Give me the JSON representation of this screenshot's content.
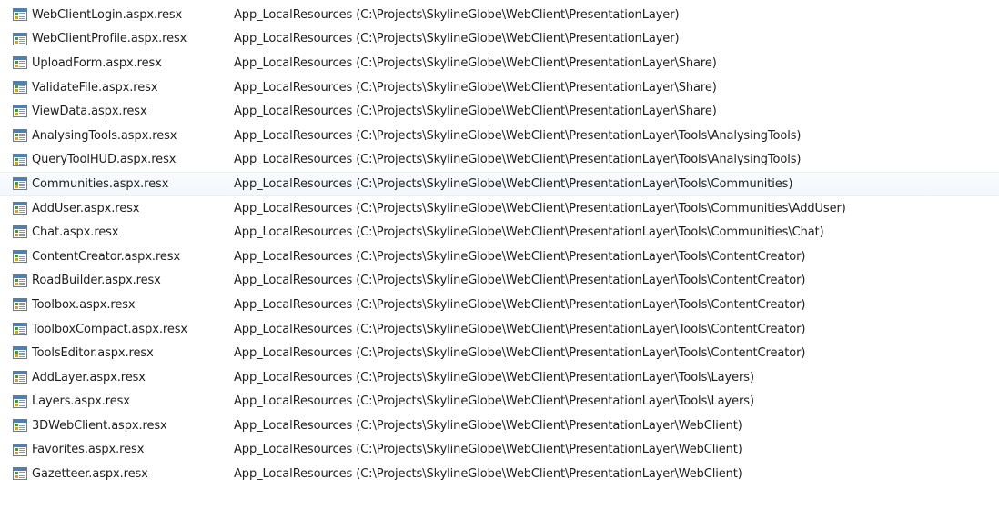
{
  "files": [
    {
      "name": "WebClientLogin.aspx.resx",
      "location": "App_LocalResources (C:\\Projects\\SkylineGlobe\\WebClient\\PresentationLayer)"
    },
    {
      "name": "WebClientProfile.aspx.resx",
      "location": "App_LocalResources (C:\\Projects\\SkylineGlobe\\WebClient\\PresentationLayer)"
    },
    {
      "name": "UploadForm.aspx.resx",
      "location": "App_LocalResources (C:\\Projects\\SkylineGlobe\\WebClient\\PresentationLayer\\Share)"
    },
    {
      "name": "ValidateFile.aspx.resx",
      "location": "App_LocalResources (C:\\Projects\\SkylineGlobe\\WebClient\\PresentationLayer\\Share)"
    },
    {
      "name": "ViewData.aspx.resx",
      "location": "App_LocalResources (C:\\Projects\\SkylineGlobe\\WebClient\\PresentationLayer\\Share)"
    },
    {
      "name": "AnalysingTools.aspx.resx",
      "location": "App_LocalResources (C:\\Projects\\SkylineGlobe\\WebClient\\PresentationLayer\\Tools\\AnalysingTools)"
    },
    {
      "name": "QueryToolHUD.aspx.resx",
      "location": "App_LocalResources (C:\\Projects\\SkylineGlobe\\WebClient\\PresentationLayer\\Tools\\AnalysingTools)"
    },
    {
      "name": "Communities.aspx.resx",
      "location": "App_LocalResources (C:\\Projects\\SkylineGlobe\\WebClient\\PresentationLayer\\Tools\\Communities)",
      "selected": true
    },
    {
      "name": "AddUser.aspx.resx",
      "location": "App_LocalResources (C:\\Projects\\SkylineGlobe\\WebClient\\PresentationLayer\\Tools\\Communities\\AddUser)"
    },
    {
      "name": "Chat.aspx.resx",
      "location": "App_LocalResources (C:\\Projects\\SkylineGlobe\\WebClient\\PresentationLayer\\Tools\\Communities\\Chat)"
    },
    {
      "name": "ContentCreator.aspx.resx",
      "location": "App_LocalResources (C:\\Projects\\SkylineGlobe\\WebClient\\PresentationLayer\\Tools\\ContentCreator)"
    },
    {
      "name": "RoadBuilder.aspx.resx",
      "location": "App_LocalResources (C:\\Projects\\SkylineGlobe\\WebClient\\PresentationLayer\\Tools\\ContentCreator)"
    },
    {
      "name": "Toolbox.aspx.resx",
      "location": "App_LocalResources (C:\\Projects\\SkylineGlobe\\WebClient\\PresentationLayer\\Tools\\ContentCreator)"
    },
    {
      "name": "ToolboxCompact.aspx.resx",
      "location": "App_LocalResources (C:\\Projects\\SkylineGlobe\\WebClient\\PresentationLayer\\Tools\\ContentCreator)"
    },
    {
      "name": "ToolsEditor.aspx.resx",
      "location": "App_LocalResources (C:\\Projects\\SkylineGlobe\\WebClient\\PresentationLayer\\Tools\\ContentCreator)"
    },
    {
      "name": "AddLayer.aspx.resx",
      "location": "App_LocalResources (C:\\Projects\\SkylineGlobe\\WebClient\\PresentationLayer\\Tools\\Layers)"
    },
    {
      "name": "Layers.aspx.resx",
      "location": "App_LocalResources (C:\\Projects\\SkylineGlobe\\WebClient\\PresentationLayer\\Tools\\Layers)"
    },
    {
      "name": "3DWebClient.aspx.resx",
      "location": "App_LocalResources (C:\\Projects\\SkylineGlobe\\WebClient\\PresentationLayer\\WebClient)"
    },
    {
      "name": "Favorites.aspx.resx",
      "location": "App_LocalResources (C:\\Projects\\SkylineGlobe\\WebClient\\PresentationLayer\\WebClient)"
    },
    {
      "name": "Gazetteer.aspx.resx",
      "location": "App_LocalResources (C:\\Projects\\SkylineGlobe\\WebClient\\PresentationLayer\\WebClient)"
    }
  ],
  "icon": "resx-file-icon",
  "colors": {
    "selected_row": "#f2f7fc",
    "text": "#1e1e1e"
  }
}
